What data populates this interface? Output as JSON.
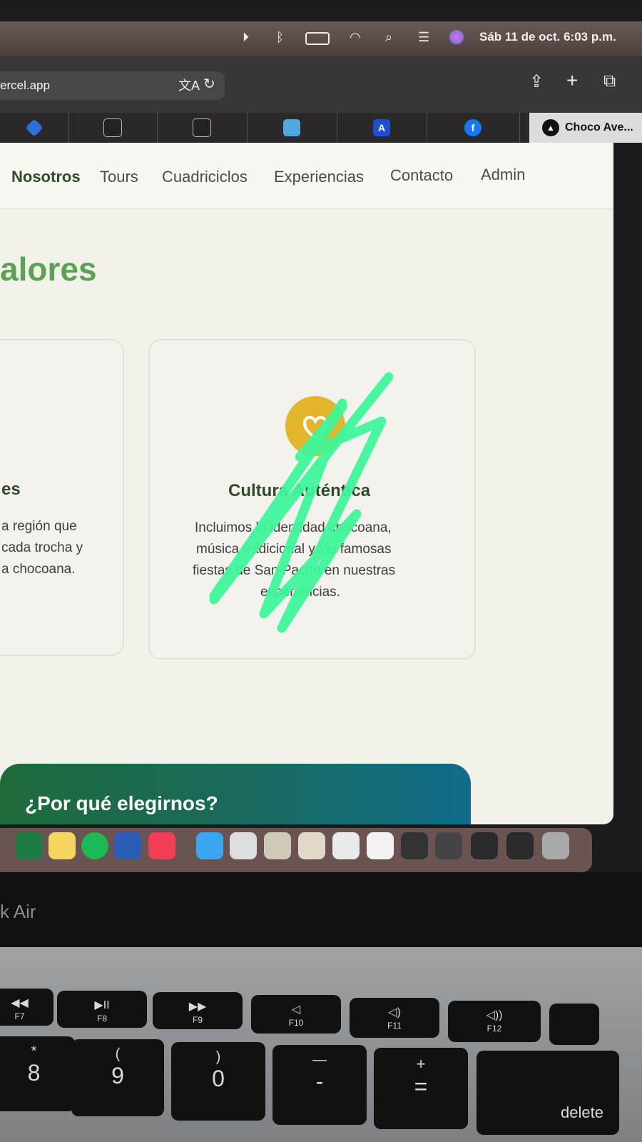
{
  "menubar": {
    "datetime": "Sáb 11 de oct.  6:03 p.m."
  },
  "browser": {
    "url": "ercel.app",
    "last_tab_label": "Choco Ave..."
  },
  "nav": {
    "links": [
      "Nosotros",
      "Tours",
      "Cuadriciclos",
      "Experiencias",
      "Contacto",
      "Admin"
    ]
  },
  "section": {
    "heading": "alores"
  },
  "cards": [
    {
      "title": "es",
      "lines": [
        "a región que",
        "cada trocha y",
        "a chocoana."
      ]
    },
    {
      "title": "Cultura Auténtica",
      "lines": [
        "Incluimos la identidad chocoana,",
        "música tradicional y las famosas",
        "fiestas de San Pacho en nuestras",
        "experiencias."
      ]
    }
  ],
  "banner": {
    "title": "¿Por qué elegirnos?"
  },
  "laptop": {
    "model": "k Air"
  },
  "keys": {
    "f7": "F7",
    "f8": "F8",
    "f9": "F9",
    "f10": "F10",
    "f11": "F11",
    "f12": "F12",
    "k8_top": "*",
    "k8": "8",
    "k9_top": "(",
    "k9": "9",
    "k0_top": ")",
    "k0": "0",
    "minus_top": "—",
    "minus": "-",
    "plus_top": "+",
    "plus": "=",
    "delete": "delete"
  },
  "colors": {
    "accent_green": "#5aa451",
    "icon_yellow": "#e3b52a",
    "scribble": "#3df59a"
  }
}
